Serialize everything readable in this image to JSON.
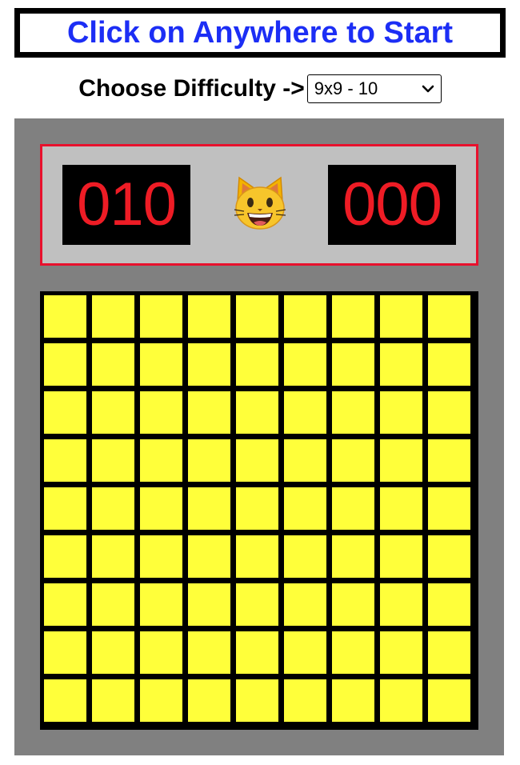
{
  "banner": {
    "text": "Click on Anywhere to Start",
    "color": "#1c2ef5"
  },
  "difficulty": {
    "label": "Choose Difficulty ->",
    "selected": "9x9 - 10"
  },
  "game": {
    "mine_counter": "010",
    "timer": "000",
    "face": "grinning-cat-face-icon",
    "rows": 9,
    "cols": 9,
    "cell_state": "unrevealed",
    "colors": {
      "panel": "#808080",
      "header_bg": "#c0c0c0",
      "header_border": "#e8112d",
      "counter_bg": "#000000",
      "counter_digits": "#ee1c25",
      "cell": "#ffff3a",
      "grid_lines": "#000000"
    }
  }
}
